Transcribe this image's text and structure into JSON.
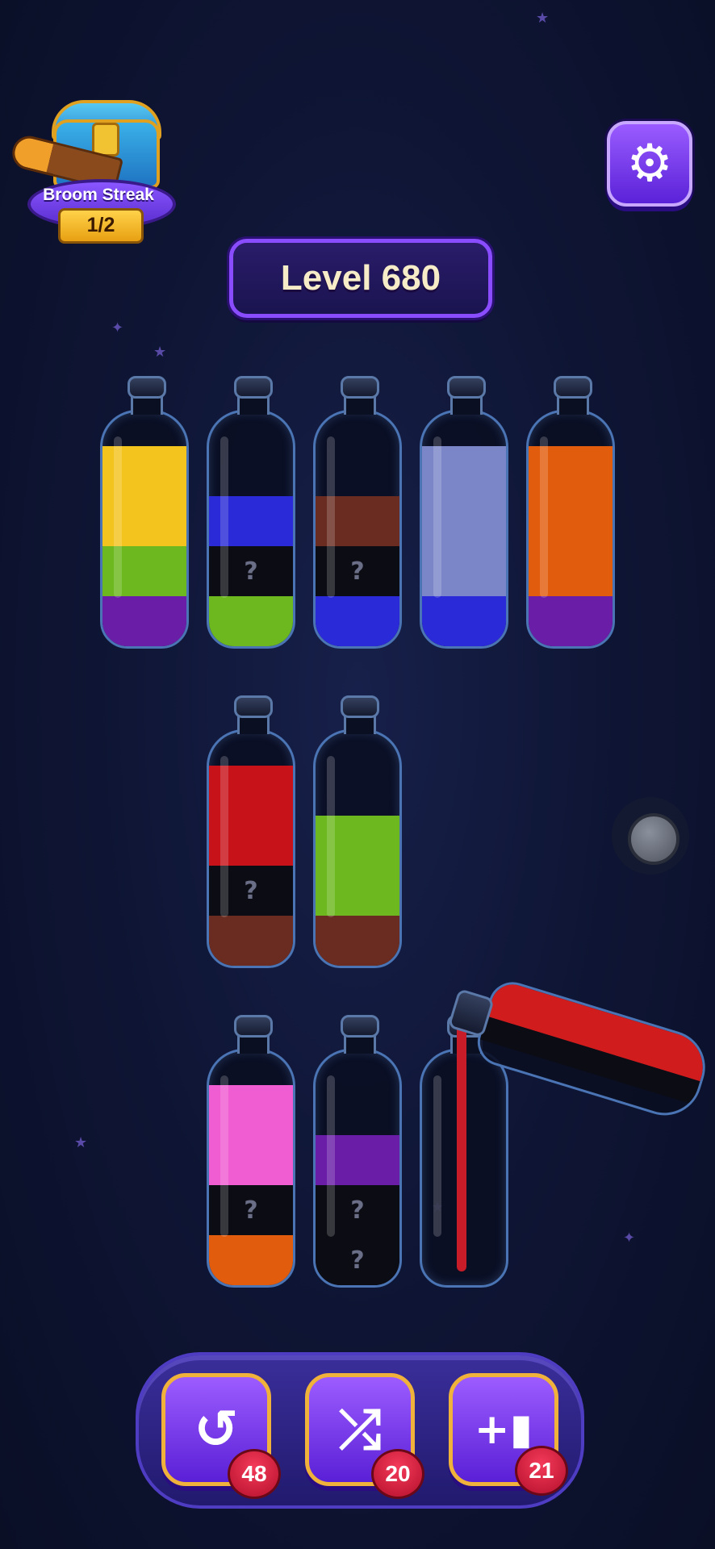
{
  "streak": {
    "title": "Broom Streak",
    "progress": "1/2"
  },
  "level": {
    "label": "Level 680"
  },
  "colors": {
    "yellow": "#f3c31e",
    "lime": "#6cb81e",
    "purple": "#6a1ea8",
    "blue": "#2a2ad8",
    "black": "#0c0c14",
    "brown": "#6a2c20",
    "lavender": "#7a86c8",
    "orange": "#e25c0e",
    "red": "#c8121a",
    "pink": "#f05cd2",
    "accent": "#8a4cff"
  },
  "bottles_row1": [
    {
      "layers": [
        "purple",
        "lime",
        "yellow",
        "yellow"
      ]
    },
    {
      "layers": [
        "lime",
        "hidden",
        "blue"
      ]
    },
    {
      "layers": [
        "blue",
        "hidden",
        "brown"
      ]
    },
    {
      "layers": [
        "blue",
        "lavender",
        "lavender",
        "lavender"
      ]
    },
    {
      "layers": [
        "purple",
        "orange",
        "orange",
        "orange"
      ]
    }
  ],
  "bottles_row2": [
    {
      "layers": [
        "brown",
        "hidden",
        "red",
        "red"
      ]
    },
    {
      "layers": [
        "brown",
        "lime",
        "lime"
      ]
    }
  ],
  "bottles_row3": [
    {
      "layers": [
        "orange",
        "hidden",
        "pink",
        "pink"
      ]
    },
    {
      "layers": [
        "hidden",
        "hidden",
        "purple"
      ]
    },
    {
      "layers": []
    }
  ],
  "hidden_mark": "?",
  "powerups": {
    "undo": {
      "icon": "undo-icon",
      "glyph": "↺",
      "count": "48"
    },
    "shuffle": {
      "icon": "shuffle-icon",
      "glyph": "⤮",
      "count": "20"
    },
    "add_bottle": {
      "icon": "add-bottle-icon",
      "glyph": "+▮",
      "count": "21"
    }
  }
}
